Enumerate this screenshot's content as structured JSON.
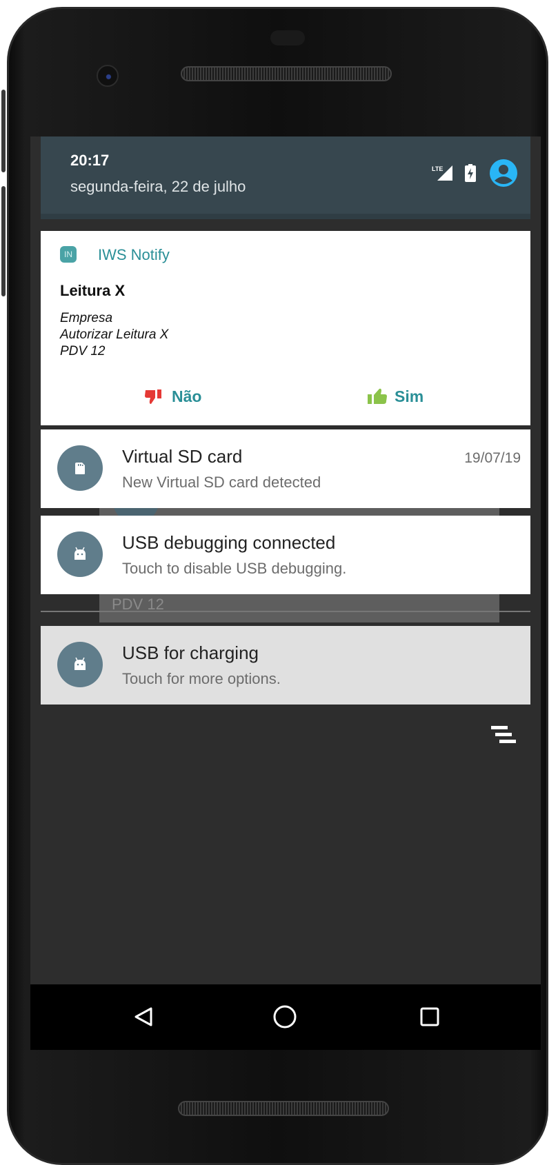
{
  "status_bar": {
    "time": "20:17",
    "date": "segunda-feira, 22 de julho",
    "icons": [
      "lte-signal-icon",
      "battery-charging-icon",
      "account-icon"
    ],
    "lte_label": "LTE"
  },
  "iws_notification": {
    "app_name": "IWS Notify",
    "app_icon_text": "IN",
    "title": "Leitura X",
    "lines": [
      "Empresa",
      "Autorizar Leitura X",
      "PDV 12"
    ],
    "actions": {
      "no": "Não",
      "yes": "Sim"
    },
    "colors": {
      "accent": "#2a8f97",
      "no_icon": "#e53935",
      "yes_icon": "#8bc34a"
    }
  },
  "notifications": [
    {
      "title": "Virtual SD card",
      "text": "New Virtual SD card detected",
      "date": "19/07/19",
      "icon": "sd-card-icon"
    },
    {
      "title": "USB debugging connected",
      "text": "Touch to disable USB debugging.",
      "icon": "android-icon"
    },
    {
      "title": "USB for charging",
      "text": "Touch for more options.",
      "icon": "android-icon"
    }
  ],
  "background_overlay": {
    "text": "PDV 12"
  },
  "navigation": [
    "back-icon",
    "home-icon",
    "recents-icon"
  ]
}
